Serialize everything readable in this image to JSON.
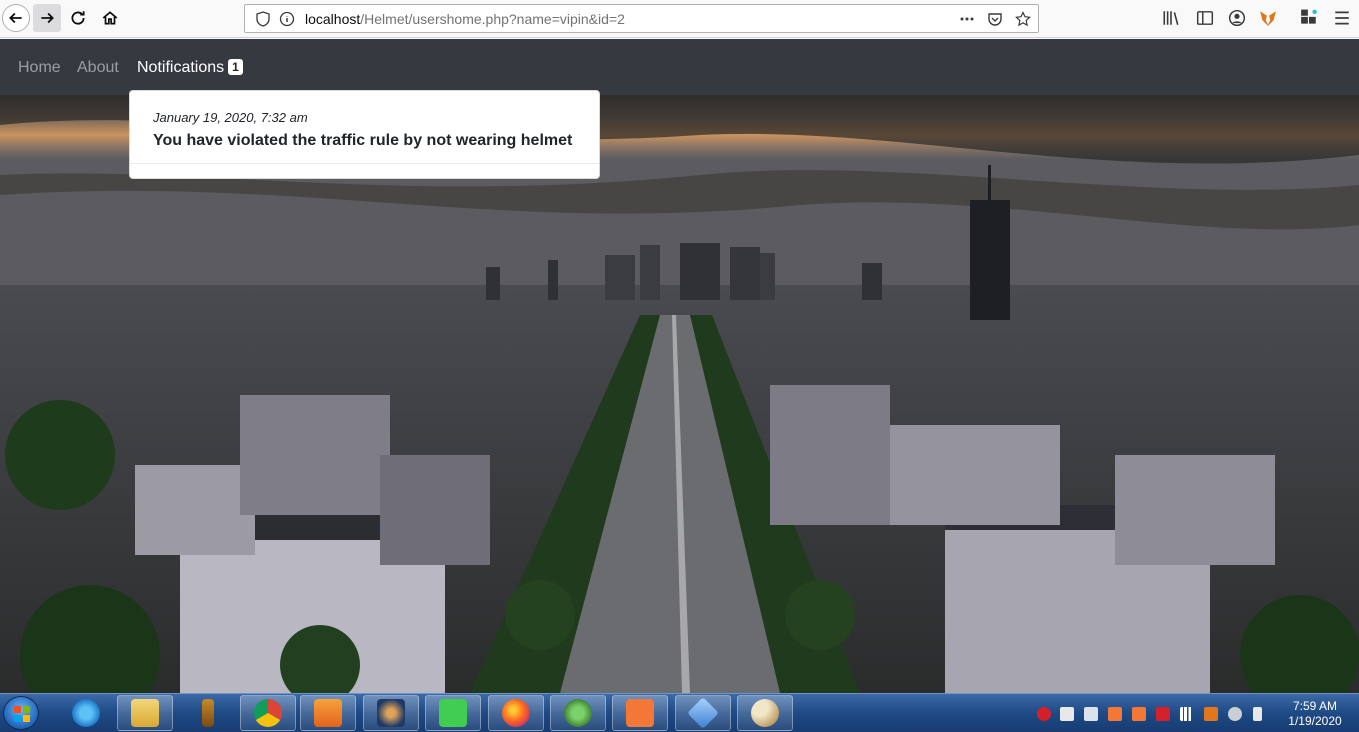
{
  "browser": {
    "url_host": "localhost",
    "url_path": "/Helmet/usershome.php?name=vipin&id=2"
  },
  "navbar": {
    "items": [
      {
        "label": "Home"
      },
      {
        "label": "About"
      },
      {
        "label": "Notifications",
        "badge": "1"
      }
    ]
  },
  "notification": {
    "date": "January 19, 2020, 7:32 am",
    "message": "You have violated the traffic rule by not wearing helmet"
  },
  "taskbar": {
    "time": "7:59 AM",
    "date": "1/19/2020"
  },
  "colors": {
    "navbar": "#343a40",
    "dropdown_bg": "#ffffff",
    "taskbar": "#1e4a85"
  }
}
